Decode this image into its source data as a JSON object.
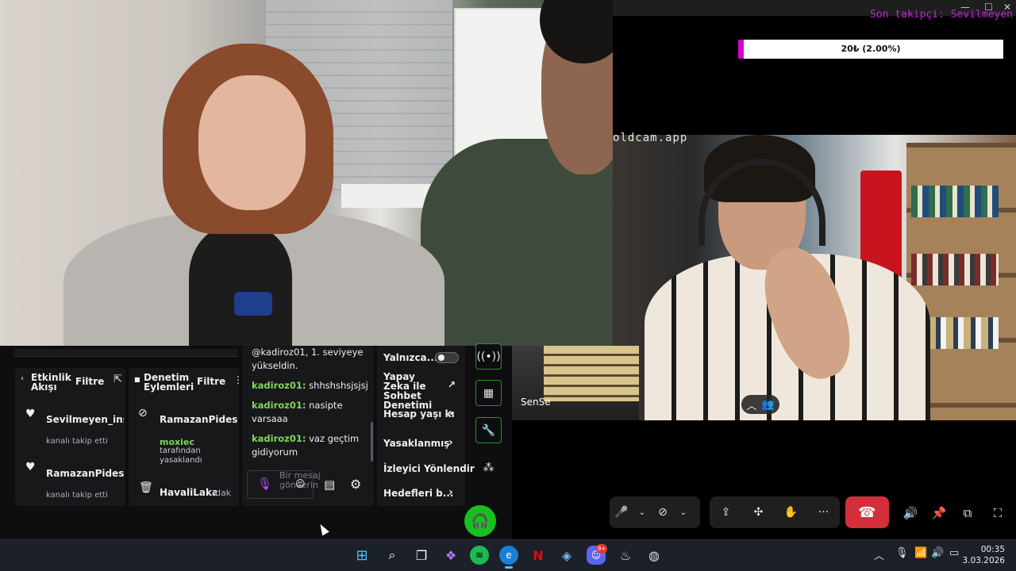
{
  "overlay": {
    "follower_text": "Son takipçi: Sevilmeyen",
    "goal_text": "20₺ (2.00%)",
    "goal_progress": 0.02,
    "watermark": "oldcam.app",
    "cam_label": "SenSe",
    "colors": {
      "follower": "#c026d3",
      "goal_fill": "#d400d4"
    }
  },
  "activity": {
    "title": "Etkinlik Akışı",
    "filter": "Filtre",
    "items": [
      {
        "name": "Sevilmeyen_ins",
        "action": "kanalı takip etti",
        "icon": "heart-icon"
      },
      {
        "name": "RamazanPidesi",
        "action": "kanalı takip etti",
        "icon": "heart-icon"
      }
    ]
  },
  "moderation": {
    "title": "Denetim Eylemleri",
    "filter": "Filtre",
    "items": [
      {
        "name": "RamazanPidesi",
        "icon": "ban-icon"
      },
      {
        "name": "moxiec",
        "detail": "tarafından yasaklandı"
      },
      {
        "name": "HavaliLakap",
        "suffix": "dak",
        "icon": "trash-icon"
      }
    ]
  },
  "chat": {
    "messages": [
      {
        "user": "",
        "text": "@kadiroz01, 1. seviyeye yükseldin."
      },
      {
        "user": "kadiroz01:",
        "text": " shhshshsjsjsj"
      },
      {
        "user": "kadiroz01:",
        "text": " nasipte varsaaa"
      },
      {
        "user": "kadiroz01:",
        "text": " vaz geçtim gidiyorum"
      }
    ],
    "placeholder": "Bir mesaj gönderin"
  },
  "mod_tools": {
    "items": [
      {
        "label": "Yalnızca...",
        "type": "toggle",
        "on": false
      },
      {
        "label": "Yapay Zeka ile Sohbet Denetimi",
        "type": "external"
      },
      {
        "label": "Hesap yaşı kı",
        "type": "chevron"
      },
      {
        "label": "Yasaklanmış",
        "type": "chevron"
      },
      {
        "label": "İzleyici Yönlendir",
        "type": "none"
      },
      {
        "label": "Hedefleri b...",
        "type": "chevron"
      }
    ]
  },
  "clock": {
    "time": "00:35",
    "date": "3.03.2026"
  },
  "taskbar": {
    "icons": [
      "windows-start",
      "search",
      "task-view",
      "copilot",
      "spotify",
      "edge",
      "netflix",
      "app-grid",
      "discord",
      "steam",
      "browser"
    ],
    "discord_badge": "9+"
  }
}
